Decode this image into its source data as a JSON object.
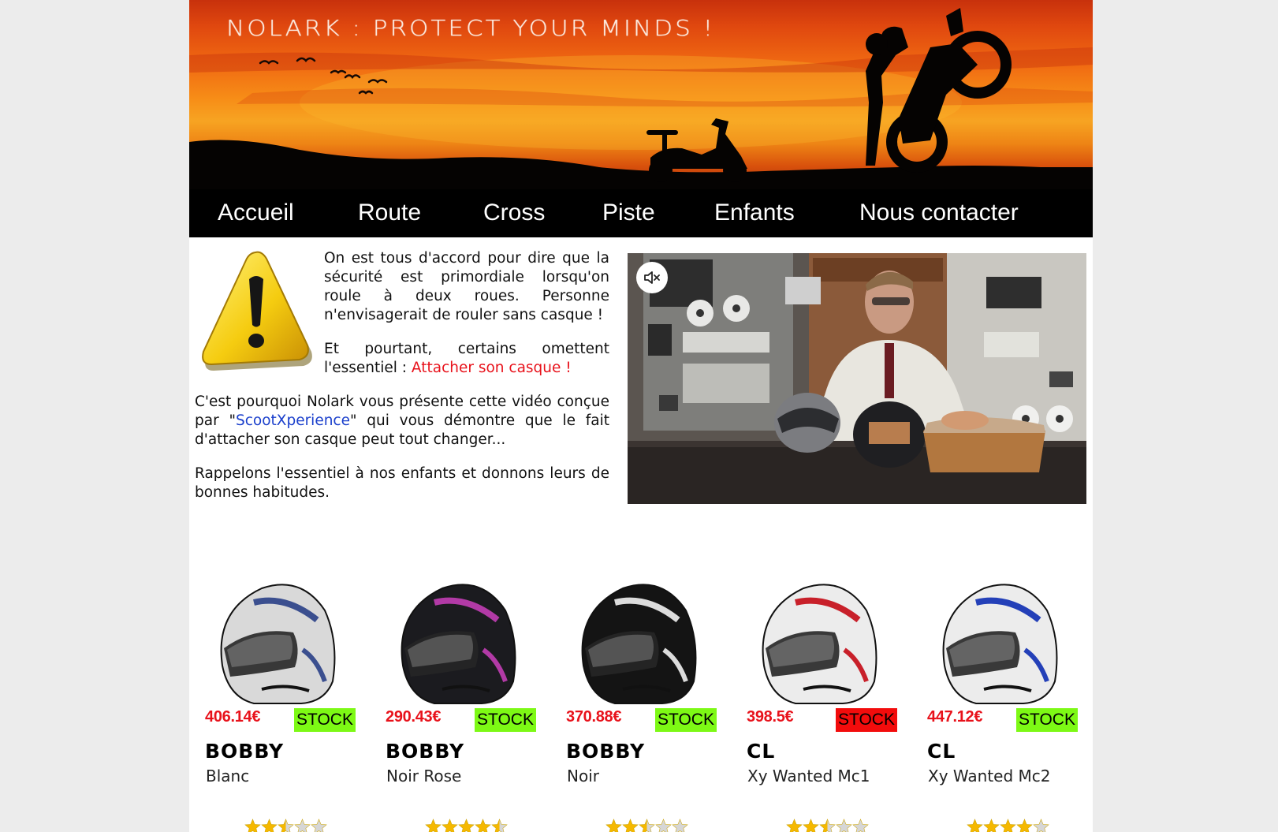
{
  "banner": {
    "title": "Nolark : Protect your minds !"
  },
  "nav": {
    "items": [
      {
        "label": "Accueil"
      },
      {
        "label": "Route"
      },
      {
        "label": "Cross"
      },
      {
        "label": "Piste"
      },
      {
        "label": "Enfants"
      },
      {
        "label": "Nous contacter"
      }
    ]
  },
  "intro": {
    "p1": "On est tous d'accord pour dire que la sécurité est primordiale lorsqu'on roule à deux roues. Personne n'envisagerait de rouler sans casque !",
    "p2_before": "Et pourtant, certains omettent l'essentiel : ",
    "p2_highlight": "Attacher son casque !",
    "p3_before": "C'est pourquoi Nolark vous présente cette vidéo conçue par \"",
    "p3_link": "ScootXperience",
    "p3_after": "\" qui vous démontre que le fait d'attacher son casque peut tout changer...",
    "p4": "Rappelons l'essentiel à nos enfants et donnons leurs de bonnes habitudes."
  },
  "video": {
    "mute_icon": "speaker-muted-icon"
  },
  "colors": {
    "nav_bg": "#000000",
    "price": "#e8121b",
    "stock_available": "#7df915",
    "stock_unavailable": "#f20c0c",
    "link": "#1a3fcc"
  },
  "products": [
    {
      "price": "406.14€",
      "stock": "STOCK",
      "in_stock": true,
      "brand": "Bobby",
      "model": "Blanc",
      "rating": 2.5,
      "helmet_color": "#d9d9d9",
      "accent": "#3b4f8f"
    },
    {
      "price": "290.43€",
      "stock": "STOCK",
      "in_stock": true,
      "brand": "Bobby",
      "model": "Noir Rose",
      "rating": 4.5,
      "helmet_color": "#1b1b1f",
      "accent": "#b23aa6"
    },
    {
      "price": "370.88€",
      "stock": "STOCK",
      "in_stock": true,
      "brand": "Bobby",
      "model": "Noir",
      "rating": 2.5,
      "helmet_color": "#141414",
      "accent": "#dcdcdc"
    },
    {
      "price": "398.5€",
      "stock": "STOCK",
      "in_stock": false,
      "brand": "CL",
      "model": "Xy Wanted Mc1",
      "rating": 2.5,
      "helmet_color": "#ececec",
      "accent": "#c8202a"
    },
    {
      "price": "447.12€",
      "stock": "STOCK",
      "in_stock": true,
      "brand": "CL",
      "model": "Xy Wanted Mc2",
      "rating": 4,
      "helmet_color": "#ececec",
      "accent": "#2440b8"
    }
  ]
}
